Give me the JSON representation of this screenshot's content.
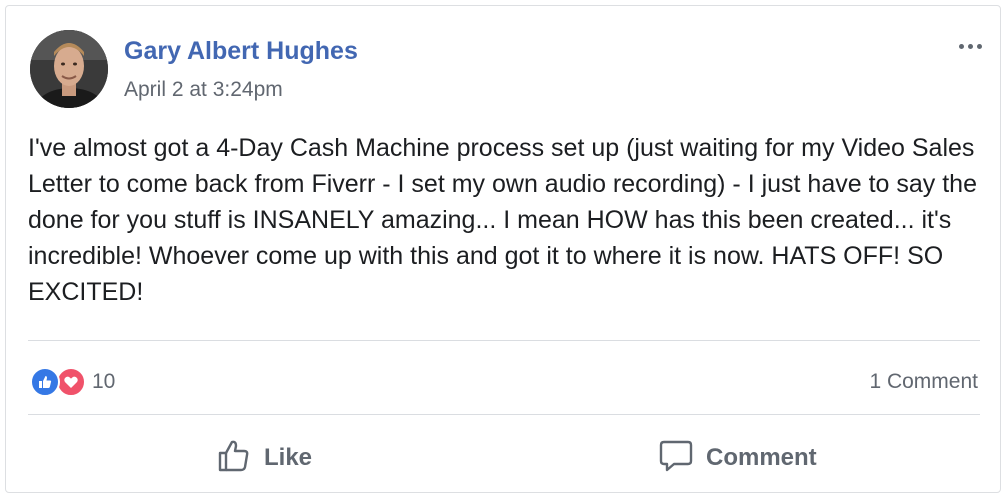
{
  "post": {
    "author": "Gary Albert Hughes",
    "timestamp": "April 2 at 3:24pm",
    "text": "I've almost got a 4-Day Cash Machine process set up (just waiting for my Video Sales Letter to come back from Fiverr - I set my own audio recording) - I just have to say the done for you stuff is INSANELY amazing... I mean HOW has this been created... it's incredible! Whoever come up with this and got it to where it is now. HATS OFF! SO EXCITED!"
  },
  "reactions": {
    "types": [
      "like-icon",
      "love-icon"
    ],
    "count": "10"
  },
  "comments": {
    "count_label": "1 Comment"
  },
  "actions": {
    "like_label": "Like",
    "comment_label": "Comment"
  },
  "colors": {
    "name_link": "#4267b2",
    "secondary_text": "#616770",
    "like_blue": "#3578e5",
    "love_red": "#f0526a"
  }
}
